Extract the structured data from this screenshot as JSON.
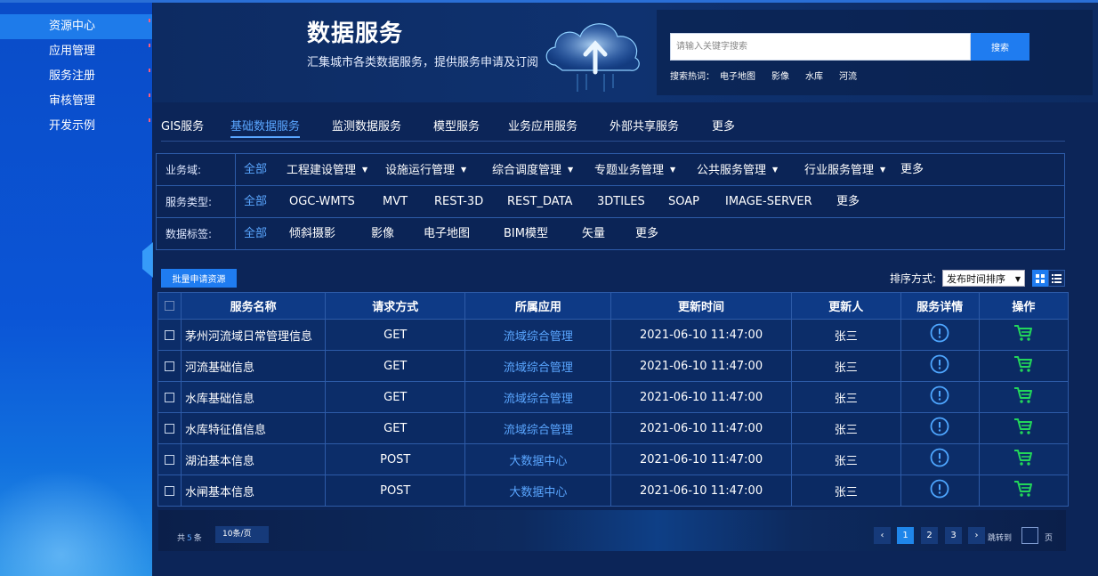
{
  "sidebar": {
    "items": [
      {
        "label": "资源中心",
        "active": true
      },
      {
        "label": "应用管理"
      },
      {
        "label": "服务注册"
      },
      {
        "label": "审核管理"
      },
      {
        "label": "开发示例"
      }
    ]
  },
  "header": {
    "title": "数据服务",
    "subtitle": "汇集城市各类数据服务，提供服务申请及订阅",
    "search": {
      "placeholder": "请输入关键字搜索",
      "button_label": "搜索",
      "hot_label": "搜索热词：",
      "hot_words": [
        "电子地图",
        "影像",
        "水库",
        "河流"
      ]
    }
  },
  "tabs": [
    "GIS服务",
    "基础数据服务",
    "监测数据服务",
    "模型服务",
    "业务应用服务",
    "外部共享服务",
    "更多"
  ],
  "active_tab": "基础数据服务",
  "filters": {
    "domain": {
      "label": "业务域:",
      "options": [
        "全部",
        "工程建设管理",
        "设施运行管理",
        "综合调度管理",
        "专题业务管理",
        "公共服务管理",
        "行业服务管理",
        "更多"
      ]
    },
    "type": {
      "label": "服务类型:",
      "options": [
        "全部",
        "OGC-WMTS",
        "MVT",
        "REST-3D",
        "REST_DATA",
        "3DTILES",
        "SOAP",
        "IMAGE-SERVER",
        "更多"
      ]
    },
    "tag": {
      "label": "数据标签:",
      "options": [
        "全部",
        "倾斜摄影",
        "影像",
        "电子地图",
        "BIM模型",
        "矢量",
        "更多"
      ]
    }
  },
  "toolbar": {
    "batch_label": "批量申请资源",
    "sort_label": "排序方式:",
    "sort_value": "发布时间排序"
  },
  "table": {
    "headers": [
      "服务名称",
      "请求方式",
      "所属应用",
      "更新时间",
      "更新人",
      "服务详情",
      "操作"
    ],
    "rows": [
      {
        "name": "茅州河流域日常管理信息",
        "method": "GET",
        "app": "流域综合管理",
        "time": "2021-06-10 11:47:00",
        "user": "张三"
      },
      {
        "name": "河流基础信息",
        "method": "GET",
        "app": "流域综合管理",
        "time": "2021-06-10 11:47:00",
        "user": "张三"
      },
      {
        "name": "水库基础信息",
        "method": "GET",
        "app": "流域综合管理",
        "time": "2021-06-10 11:47:00",
        "user": "张三"
      },
      {
        "name": "水库特征值信息",
        "method": "GET",
        "app": "流域综合管理",
        "time": "2021-06-10 11:47:00",
        "user": "张三"
      },
      {
        "name": "湖泊基本信息",
        "method": "POST",
        "app": "大数据中心",
        "time": "2021-06-10 11:47:00",
        "user": "张三"
      },
      {
        "name": "水闸基本信息",
        "method": "POST",
        "app": "大数据中心",
        "time": "2021-06-10 11:47:00",
        "user": "张三"
      }
    ]
  },
  "pagination": {
    "total_prefix": "共",
    "total": "5",
    "total_suffix": "条",
    "page_size": "10条/页",
    "pages": [
      "1",
      "2",
      "3"
    ],
    "current": "1",
    "prev": "‹",
    "next": "›",
    "jump_label": "跳转到",
    "page_suffix": "页"
  },
  "colors": {
    "accent": "#1f7cf0",
    "link": "#5aa6ff",
    "cart": "#22d65a",
    "background": "#0b2456"
  }
}
